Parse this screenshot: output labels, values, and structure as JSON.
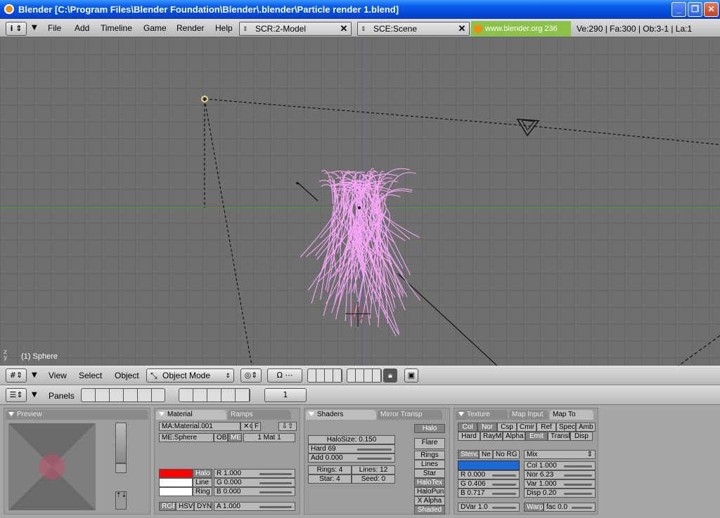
{
  "window": {
    "title": "Blender [C:\\Program Files\\Blender Foundation\\Blender\\.blender\\Particle render 1.blend]"
  },
  "info_header": {
    "menus": [
      "File",
      "Add",
      "Timeline",
      "Game",
      "Render",
      "Help"
    ],
    "screen_field": "SCR:2-Model",
    "scene_field": "SCE:Scene",
    "website": "www.blender.org 236",
    "stats": "Ve:290 | Fa:300 | Ob:3-1 | La:1"
  },
  "viewport": {
    "object_label": "(1) Sphere",
    "hair_color": "#f4a6f4",
    "axis_labels": {
      "z": "z",
      "y": "y"
    }
  },
  "view3d_header": {
    "menus": [
      "View",
      "Select",
      "Object"
    ],
    "mode": "Object Mode"
  },
  "buttons_header": {
    "panels_label": "Panels",
    "frame": "1"
  },
  "preview_panel": {
    "tab": "Preview"
  },
  "material_panel": {
    "tabs": [
      "Material",
      "Ramps"
    ],
    "material_name": "MA:Material.001",
    "f_label": "F",
    "mesh_name": "ME:Sphere",
    "ob_label": "OB",
    "me_label": "ME",
    "mat_index": "1 Mat 1",
    "color_rows": [
      {
        "label": "Halo",
        "swatch": "#ff0000"
      },
      {
        "label": "Line",
        "swatch": "#ffffff"
      },
      {
        "label": "Ring",
        "swatch": "#ffffff"
      }
    ],
    "rgb": {
      "r": "R 1.000",
      "g": "G 0.000",
      "b": "B 0.000",
      "a": "A 1.000"
    },
    "modes": [
      "RGB",
      "HSV",
      "DYN"
    ]
  },
  "shaders_panel": {
    "tabs": [
      "Shaders",
      "Mirror Transp"
    ],
    "halo_label": "Halo",
    "halo_size": "HaloSize: 0.150",
    "hard": "Hard 69",
    "add": "Add  0.000",
    "rings": "Rings: 4",
    "lines": "Lines: 12",
    "star": "Star: 4",
    "seed": "Seed: 0",
    "toggles": [
      "Flare",
      "Rings",
      "Lines",
      "Star",
      "HaloTex",
      "HaloPun",
      "X Alpha",
      "Shaded"
    ]
  },
  "mapto_panel": {
    "tabs": [
      "Texture",
      "Map Input",
      "Map To"
    ],
    "channels_row1": [
      "Col",
      "Nor",
      "Csp",
      "Cmir",
      "Ref",
      "Spec",
      "Amb"
    ],
    "channels_row2": [
      "Hard",
      "RayMi",
      "Alpha",
      "Emit",
      "Translu",
      "Disp"
    ],
    "blend_toggles": [
      "Stenc",
      "Ne",
      "No RG"
    ],
    "blend_mode": "Mix",
    "tex_color": "#1c6ad6",
    "r": "R 0.000",
    "g": "G 0.406",
    "b": "B 0.717",
    "col": "Col 1.000",
    "nor": "Nor 6.23",
    "var": "Var 1.000",
    "disp": "Disp 0.20",
    "dvar": "DVar 1.0",
    "warp": "Warp",
    "fac": "fac 0.0"
  }
}
